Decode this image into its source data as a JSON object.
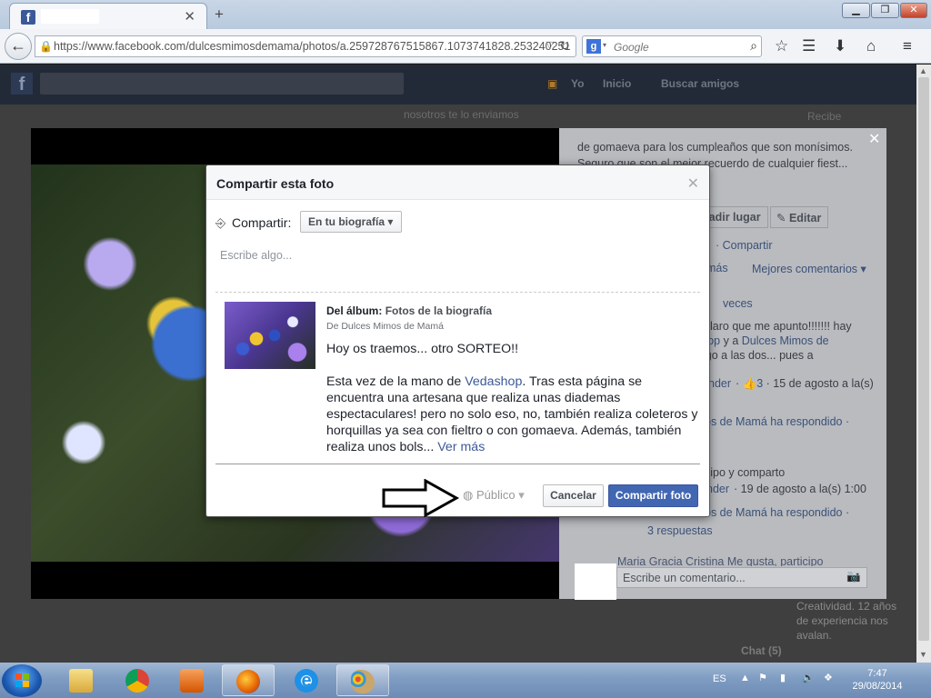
{
  "browser": {
    "url_domain": "https://www.facebook.com",
    "url_path": "/dulcesmimosdemama/photos/a.259728767515867.1073741828.253240251",
    "search_placeholder": "Google"
  },
  "fb": {
    "nav_yo": "Yo",
    "nav_inicio": "Inicio",
    "nav_buscar": "Buscar amigos"
  },
  "panel": {
    "top_comment_1": "nosotros te lo enviamos",
    "recibe": "Recibe",
    "caption_1": "de gomaeva para los cumpleaños que son monísimos.",
    "caption_2": "Seguro que son el mejor recuerdo de cualquier fiest...",
    "add_place": "ñadir lugar",
    "edit": "Editar",
    "share_link": "Compartir",
    "mas": "más",
    "best_comments": "Mejores comentarios",
    "veces": "veces",
    "c1a": "laro que me apunto!!!!!!! hay",
    "c1b": "shop",
    "c1c": "y a",
    "c1d": "Dulces Mimos de",
    "c1e": "igo a las dos... pues a",
    "c1f": "nder",
    "c1likes": "3",
    "c1date": "15 de agosto a la(s)",
    "reply1": "os de Mamá ha respondido",
    "c2a": "cipo y comparto",
    "c2b": "nder",
    "c2date": "19 de agosto a la(s) 1:00",
    "reply2": "os de Mamá ha respondido",
    "replies": "3 respuestas",
    "c3": "Maria Gracia Cristina Me gusta, participo",
    "comment_placeholder": "Escribe un comentario...",
    "bg_1": "Creatividad. 12 años",
    "bg_2": "de experiencia nos",
    "bg_3": "avalan.",
    "chat": "Chat (5)"
  },
  "modal": {
    "title": "Compartir esta foto",
    "share_label": "Compartir:",
    "share_target": "En tu biografía",
    "placeholder": "Escribe algo...",
    "album_prefix": "Del álbum:",
    "album_name": "Fotos de la biografía",
    "byline": "De Dulces Mimos de Mamá",
    "body_1": "Hoy os traemos... otro SORTEO!!",
    "body_2a": "Esta vez de la mano de ",
    "body_2link": "Vedashop",
    "body_2b": ". Tras esta página se encuentra una artesana que realiza unas diademas espectaculares! pero no solo eso, no, también realiza coleteros y horquillas ya sea con fieltro o con gomaeva.",
    "body_3": "Además, también realiza unos bols...",
    "ver_mas": "Ver más",
    "privacy": "Público",
    "cancel": "Cancelar",
    "share_button": "Compartir foto"
  },
  "taskbar": {
    "lang": "ES",
    "time": "7:47",
    "date": "29/08/2014"
  }
}
